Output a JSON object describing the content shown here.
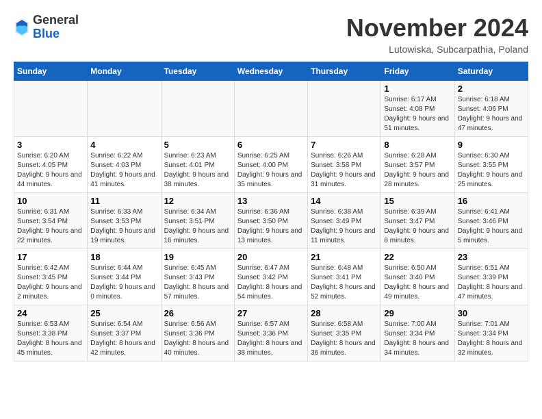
{
  "header": {
    "logo_general": "General",
    "logo_blue": "Blue",
    "month_title": "November 2024",
    "location": "Lutowiska, Subcarpathia, Poland"
  },
  "weekdays": [
    "Sunday",
    "Monday",
    "Tuesday",
    "Wednesday",
    "Thursday",
    "Friday",
    "Saturday"
  ],
  "weeks": [
    [
      {
        "day": "",
        "info": ""
      },
      {
        "day": "",
        "info": ""
      },
      {
        "day": "",
        "info": ""
      },
      {
        "day": "",
        "info": ""
      },
      {
        "day": "",
        "info": ""
      },
      {
        "day": "1",
        "info": "Sunrise: 6:17 AM\nSunset: 4:08 PM\nDaylight: 9 hours and 51 minutes."
      },
      {
        "day": "2",
        "info": "Sunrise: 6:18 AM\nSunset: 4:06 PM\nDaylight: 9 hours and 47 minutes."
      }
    ],
    [
      {
        "day": "3",
        "info": "Sunrise: 6:20 AM\nSunset: 4:05 PM\nDaylight: 9 hours and 44 minutes."
      },
      {
        "day": "4",
        "info": "Sunrise: 6:22 AM\nSunset: 4:03 PM\nDaylight: 9 hours and 41 minutes."
      },
      {
        "day": "5",
        "info": "Sunrise: 6:23 AM\nSunset: 4:01 PM\nDaylight: 9 hours and 38 minutes."
      },
      {
        "day": "6",
        "info": "Sunrise: 6:25 AM\nSunset: 4:00 PM\nDaylight: 9 hours and 35 minutes."
      },
      {
        "day": "7",
        "info": "Sunrise: 6:26 AM\nSunset: 3:58 PM\nDaylight: 9 hours and 31 minutes."
      },
      {
        "day": "8",
        "info": "Sunrise: 6:28 AM\nSunset: 3:57 PM\nDaylight: 9 hours and 28 minutes."
      },
      {
        "day": "9",
        "info": "Sunrise: 6:30 AM\nSunset: 3:55 PM\nDaylight: 9 hours and 25 minutes."
      }
    ],
    [
      {
        "day": "10",
        "info": "Sunrise: 6:31 AM\nSunset: 3:54 PM\nDaylight: 9 hours and 22 minutes."
      },
      {
        "day": "11",
        "info": "Sunrise: 6:33 AM\nSunset: 3:53 PM\nDaylight: 9 hours and 19 minutes."
      },
      {
        "day": "12",
        "info": "Sunrise: 6:34 AM\nSunset: 3:51 PM\nDaylight: 9 hours and 16 minutes."
      },
      {
        "day": "13",
        "info": "Sunrise: 6:36 AM\nSunset: 3:50 PM\nDaylight: 9 hours and 13 minutes."
      },
      {
        "day": "14",
        "info": "Sunrise: 6:38 AM\nSunset: 3:49 PM\nDaylight: 9 hours and 11 minutes."
      },
      {
        "day": "15",
        "info": "Sunrise: 6:39 AM\nSunset: 3:47 PM\nDaylight: 9 hours and 8 minutes."
      },
      {
        "day": "16",
        "info": "Sunrise: 6:41 AM\nSunset: 3:46 PM\nDaylight: 9 hours and 5 minutes."
      }
    ],
    [
      {
        "day": "17",
        "info": "Sunrise: 6:42 AM\nSunset: 3:45 PM\nDaylight: 9 hours and 2 minutes."
      },
      {
        "day": "18",
        "info": "Sunrise: 6:44 AM\nSunset: 3:44 PM\nDaylight: 9 hours and 0 minutes."
      },
      {
        "day": "19",
        "info": "Sunrise: 6:45 AM\nSunset: 3:43 PM\nDaylight: 8 hours and 57 minutes."
      },
      {
        "day": "20",
        "info": "Sunrise: 6:47 AM\nSunset: 3:42 PM\nDaylight: 8 hours and 54 minutes."
      },
      {
        "day": "21",
        "info": "Sunrise: 6:48 AM\nSunset: 3:41 PM\nDaylight: 8 hours and 52 minutes."
      },
      {
        "day": "22",
        "info": "Sunrise: 6:50 AM\nSunset: 3:40 PM\nDaylight: 8 hours and 49 minutes."
      },
      {
        "day": "23",
        "info": "Sunrise: 6:51 AM\nSunset: 3:39 PM\nDaylight: 8 hours and 47 minutes."
      }
    ],
    [
      {
        "day": "24",
        "info": "Sunrise: 6:53 AM\nSunset: 3:38 PM\nDaylight: 8 hours and 45 minutes."
      },
      {
        "day": "25",
        "info": "Sunrise: 6:54 AM\nSunset: 3:37 PM\nDaylight: 8 hours and 42 minutes."
      },
      {
        "day": "26",
        "info": "Sunrise: 6:56 AM\nSunset: 3:36 PM\nDaylight: 8 hours and 40 minutes."
      },
      {
        "day": "27",
        "info": "Sunrise: 6:57 AM\nSunset: 3:36 PM\nDaylight: 8 hours and 38 minutes."
      },
      {
        "day": "28",
        "info": "Sunrise: 6:58 AM\nSunset: 3:35 PM\nDaylight: 8 hours and 36 minutes."
      },
      {
        "day": "29",
        "info": "Sunrise: 7:00 AM\nSunset: 3:34 PM\nDaylight: 8 hours and 34 minutes."
      },
      {
        "day": "30",
        "info": "Sunrise: 7:01 AM\nSunset: 3:34 PM\nDaylight: 8 hours and 32 minutes."
      }
    ]
  ]
}
